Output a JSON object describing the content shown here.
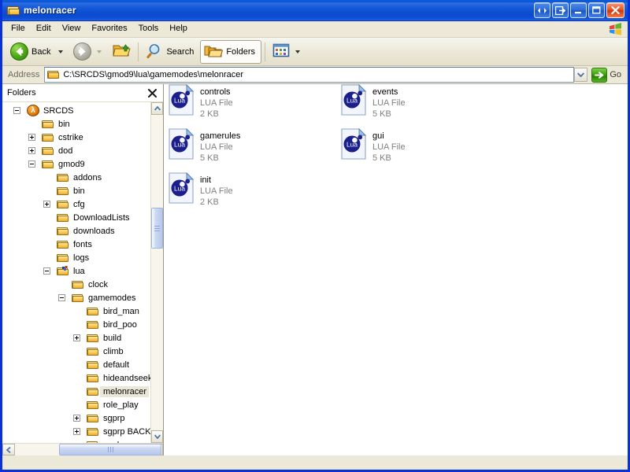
{
  "window": {
    "title": "melonracer",
    "title_icon": "folder-open-icon",
    "buttons": [
      {
        "name": "resize-arrows-button",
        "glyph": "arrows-left-right-icon"
      },
      {
        "name": "restore-group-button",
        "glyph": "box-arrow-right-icon"
      },
      {
        "name": "minimize-button",
        "glyph": "minimize-icon"
      },
      {
        "name": "maximize-button",
        "glyph": "maximize-icon"
      },
      {
        "name": "close-button",
        "glyph": "close-icon"
      }
    ]
  },
  "menubar": {
    "items": [
      "File",
      "Edit",
      "View",
      "Favorites",
      "Tools",
      "Help"
    ],
    "brand_icon": "windows-flag-icon"
  },
  "toolbar": {
    "back_label": "Back",
    "forward_label": "",
    "up_label": "",
    "search_label": "Search",
    "folders_label": "Folders",
    "views_label": "",
    "back_icon": "back-arrow-icon",
    "forward_icon": "forward-arrow-icon",
    "up_icon": "up-folder-icon",
    "search_icon": "magnifier-icon",
    "folders_icon": "folders-icon",
    "views_icon": "views-icon"
  },
  "address": {
    "label": "Address",
    "value": "C:\\SRCDS\\gmod9\\lua\\gamemodes\\melonracer",
    "icon": "folder-icon",
    "dropdown_icon": "chevron-down-icon",
    "go_label": "Go",
    "go_icon": "green-arrow-icon"
  },
  "folders_pane": {
    "title": "Folders",
    "close_icon": "close-x-icon",
    "tree": [
      {
        "label": "SRCDS",
        "depth": 0,
        "expander": "minus",
        "icon": "halflife-icon",
        "selected": false
      },
      {
        "label": "bin",
        "depth": 1,
        "expander": "none",
        "icon": "folder-icon",
        "selected": false
      },
      {
        "label": "cstrike",
        "depth": 1,
        "expander": "plus",
        "icon": "folder-icon",
        "selected": false
      },
      {
        "label": "dod",
        "depth": 1,
        "expander": "plus",
        "icon": "folder-icon",
        "selected": false
      },
      {
        "label": "gmod9",
        "depth": 1,
        "expander": "minus",
        "icon": "folder-icon",
        "selected": false
      },
      {
        "label": "addons",
        "depth": 2,
        "expander": "none",
        "icon": "folder-icon",
        "selected": false
      },
      {
        "label": "bin",
        "depth": 2,
        "expander": "none",
        "icon": "folder-icon",
        "selected": false
      },
      {
        "label": "cfg",
        "depth": 2,
        "expander": "plus",
        "icon": "folder-icon",
        "selected": false
      },
      {
        "label": "DownloadLists",
        "depth": 2,
        "expander": "none",
        "icon": "folder-icon",
        "selected": false
      },
      {
        "label": "downloads",
        "depth": 2,
        "expander": "none",
        "icon": "folder-icon",
        "selected": false
      },
      {
        "label": "fonts",
        "depth": 2,
        "expander": "none",
        "icon": "folder-icon",
        "selected": false
      },
      {
        "label": "logs",
        "depth": 2,
        "expander": "none",
        "icon": "folder-icon",
        "selected": false
      },
      {
        "label": "lua",
        "depth": 2,
        "expander": "minus",
        "icon": "folder-special-icon",
        "selected": false
      },
      {
        "label": "clock",
        "depth": 3,
        "expander": "none",
        "icon": "folder-icon",
        "selected": false
      },
      {
        "label": "gamemodes",
        "depth": 3,
        "expander": "minus",
        "icon": "folder-icon",
        "selected": false
      },
      {
        "label": "bird_man",
        "depth": 4,
        "expander": "none",
        "icon": "folder-icon",
        "selected": false
      },
      {
        "label": "bird_poo",
        "depth": 4,
        "expander": "none",
        "icon": "folder-icon",
        "selected": false
      },
      {
        "label": "build",
        "depth": 4,
        "expander": "plus",
        "icon": "folder-icon",
        "selected": false
      },
      {
        "label": "climb",
        "depth": 4,
        "expander": "none",
        "icon": "folder-icon",
        "selected": false
      },
      {
        "label": "default",
        "depth": 4,
        "expander": "none",
        "icon": "folder-icon",
        "selected": false
      },
      {
        "label": "hideandseek",
        "depth": 4,
        "expander": "none",
        "icon": "folder-icon",
        "selected": false
      },
      {
        "label": "melonracer",
        "depth": 4,
        "expander": "none",
        "icon": "folder-icon",
        "selected": true
      },
      {
        "label": "role_play",
        "depth": 4,
        "expander": "none",
        "icon": "folder-icon",
        "selected": false
      },
      {
        "label": "sgprp",
        "depth": 4,
        "expander": "plus",
        "icon": "folder-icon",
        "selected": false
      },
      {
        "label": "sgprp BACKU",
        "depth": 4,
        "expander": "plus",
        "icon": "folder-icon",
        "selected": false
      },
      {
        "label": "snakes",
        "depth": 4,
        "expander": "none",
        "icon": "folder-icon",
        "selected": false
      }
    ]
  },
  "filelist": {
    "files": [
      {
        "name": "controls",
        "type": "LUA File",
        "size": "2 KB",
        "icon": "lua-file-icon"
      },
      {
        "name": "events",
        "type": "LUA File",
        "size": "5 KB",
        "icon": "lua-file-icon"
      },
      {
        "name": "gamerules",
        "type": "LUA File",
        "size": "5 KB",
        "icon": "lua-file-icon"
      },
      {
        "name": "gui",
        "type": "LUA File",
        "size": "5 KB",
        "icon": "lua-file-icon"
      },
      {
        "name": "init",
        "type": "LUA File",
        "size": "2 KB",
        "icon": "lua-file-icon"
      }
    ],
    "lua_icon_text": "Lua"
  },
  "colors": {
    "titlebar_blue": "#0a52d8",
    "window_border": "#0831d9",
    "chrome_beige": "#ece9d8",
    "selection_inactive": "#ebe7d8",
    "meta_gray": "#808080"
  }
}
